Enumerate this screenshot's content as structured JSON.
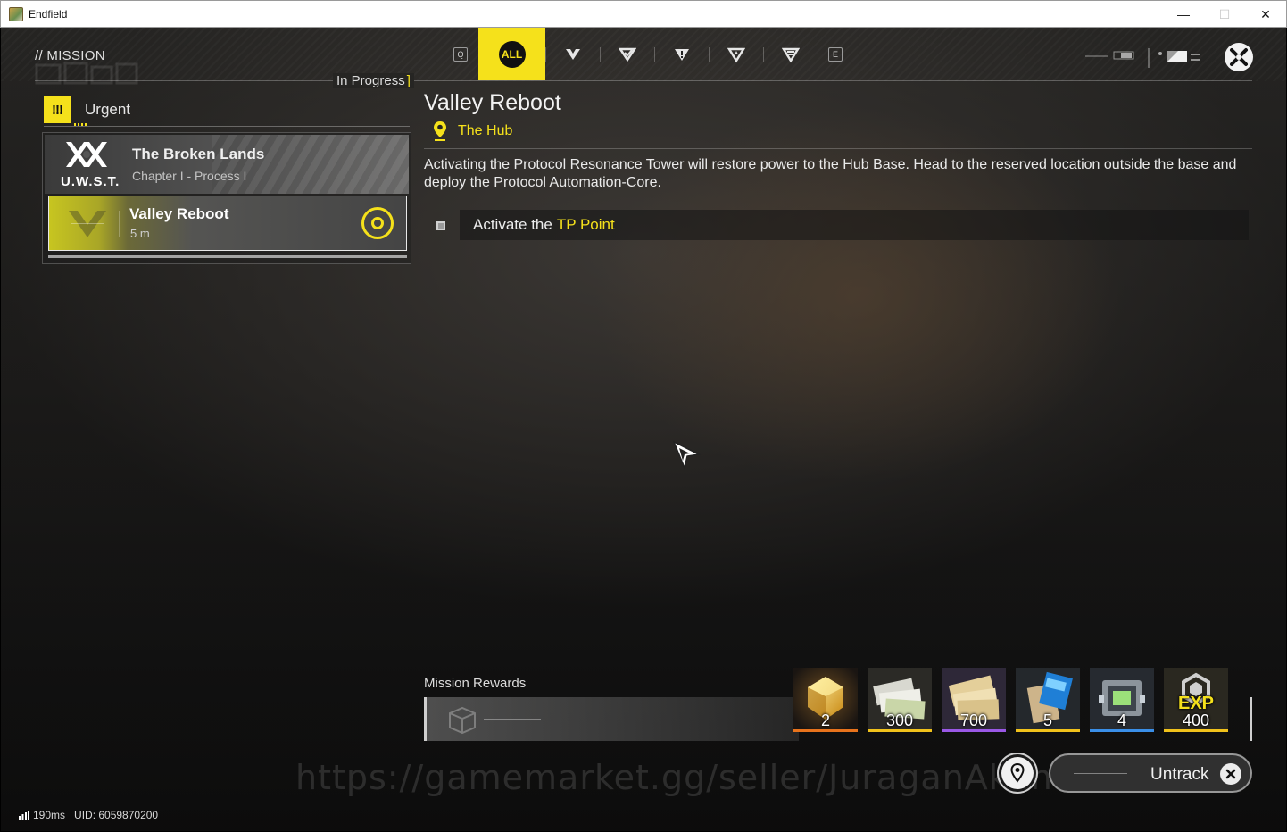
{
  "window": {
    "title": "Endfield",
    "controls": {
      "minimize": "—",
      "maximize": "☐",
      "close": "✕"
    }
  },
  "header": {
    "title": "// MISSION",
    "filters": {
      "prev_key": "Q",
      "next_key": "E",
      "active_label": "ALL",
      "categories": [
        "main-mission-icon",
        "side-mission-icon",
        "urgent-mission-icon",
        "event-mission-icon",
        "daily-mission-icon"
      ]
    }
  },
  "mission_list": {
    "section_label": "In Progress",
    "group_label": "Urgent",
    "group_icon": "!!!",
    "chapter": {
      "logo_text": "U.W.S.T.",
      "name": "The Broken Lands",
      "subtitle": "Chapter I - Process I"
    },
    "active_quest": {
      "name": "Valley Reboot",
      "distance": "5 m"
    }
  },
  "detail": {
    "title": "Valley Reboot",
    "location": "The Hub",
    "description": "Activating the Protocol Resonance Tower will restore power to the Hub Base. Head to the reserved location outside the base and deploy the Protocol Automation-Core.",
    "objective": {
      "prefix": "Activate the",
      "highlight": "TP Point"
    }
  },
  "rewards": {
    "label": "Mission Rewards",
    "items": [
      {
        "icon": "origeometry-icon",
        "qty": "2",
        "rarity_color": "#e8731c"
      },
      {
        "icon": "credit-icon",
        "qty": "300",
        "rarity_color": "#f1c21b"
      },
      {
        "icon": "currency-stack-icon",
        "qty": "700",
        "rarity_color": "#9a58e6"
      },
      {
        "icon": "exp-record-icon",
        "qty": "5",
        "rarity_color": "#f1c21b"
      },
      {
        "icon": "core-module-icon",
        "qty": "4",
        "rarity_color": "#3a8fe8"
      },
      {
        "icon": "exp-icon",
        "qty": "400",
        "rarity_color": "#f1c21b",
        "label": "EXP"
      }
    ]
  },
  "actions": {
    "untrack_label": "Untrack"
  },
  "watermark": "https://gamemarket.gg/seller/JuraganAkun",
  "status": {
    "ping": "190ms",
    "uid": "UID: 6059870200"
  },
  "colors": {
    "accent": "#f5e11b",
    "text": "#e8e8e8"
  }
}
